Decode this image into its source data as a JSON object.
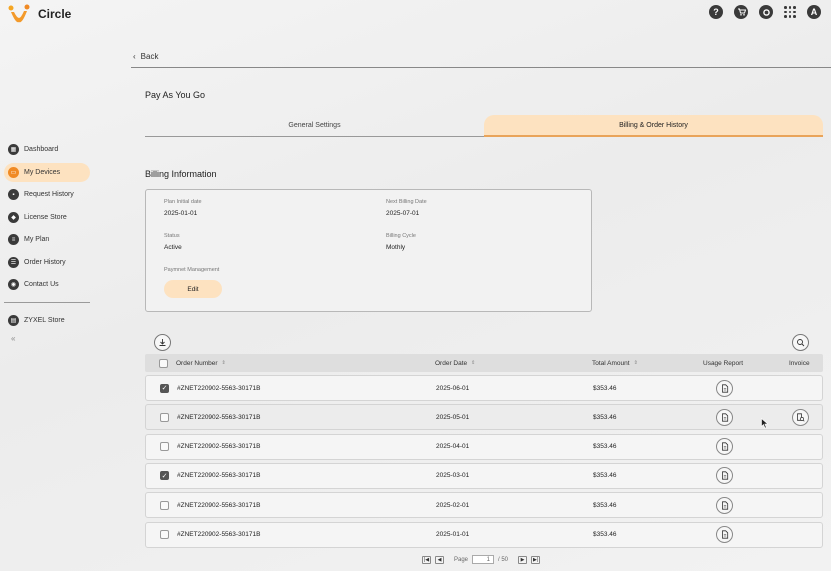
{
  "app": {
    "name": "Circle"
  },
  "header": {
    "help_icon": "question-icon",
    "cart_icon": "cart-icon",
    "settings_icon": "gear-icon",
    "apps_icon": "grid-icon",
    "avatar_letter": "A"
  },
  "sidebar": {
    "items": [
      {
        "label": "Dashboard",
        "icon": "dashboard-icon",
        "active": false
      },
      {
        "label": "My Devices",
        "icon": "devices-icon",
        "active": true
      },
      {
        "label": "Request History",
        "icon": "lock-icon",
        "active": false
      },
      {
        "label": "License Store",
        "icon": "license-icon",
        "active": false
      },
      {
        "label": "My Plan",
        "icon": "plan-icon",
        "active": false
      },
      {
        "label": "Order History",
        "icon": "order-icon",
        "active": false
      },
      {
        "label": "Contact Us",
        "icon": "contact-icon",
        "active": false
      }
    ],
    "store": {
      "label": "ZYXEL Store",
      "icon": "store-icon"
    },
    "collapse_label": "«"
  },
  "main": {
    "back_label": "Back",
    "page_title": "Pay As You Go",
    "tabs": [
      {
        "label": "General Settings",
        "active": false
      },
      {
        "label": "Billing & Order History",
        "active": true
      }
    ],
    "billing": {
      "title": "Billing Information",
      "plan_initial_date_label": "Plan Initial date",
      "plan_initial_date": "2025-01-01",
      "next_billing_date_label": "Next Billing Date",
      "next_billing_date": "2025-07-01",
      "status_label": "Status",
      "status": "Active",
      "billing_cycle_label": "Billing Cycle",
      "billing_cycle": "Mothly",
      "payment_label": "Paymnet Management",
      "edit_label": "Edit"
    },
    "table": {
      "columns": {
        "order_number": "Order Number",
        "order_date": "Order Date",
        "total_amount": "Total Amount",
        "usage_report": "Usage Report",
        "invoice": "Invoice"
      },
      "rows": [
        {
          "order": "#ZNET220902-5563-30171B",
          "date": "2025-06-01",
          "amount": "$353.46",
          "checked": true,
          "invoice": false
        },
        {
          "order": "#ZNET220902-5563-30171B",
          "date": "2025-05-01",
          "amount": "$353.46",
          "checked": false,
          "invoice": true
        },
        {
          "order": "#ZNET220902-5563-30171B",
          "date": "2025-04-01",
          "amount": "$353.46",
          "checked": false,
          "invoice": false
        },
        {
          "order": "#ZNET220902-5563-30171B",
          "date": "2025-03-01",
          "amount": "$353.46",
          "checked": true,
          "invoice": false
        },
        {
          "order": "#ZNET220902-5563-30171B",
          "date": "2025-02-01",
          "amount": "$353.46",
          "checked": false,
          "invoice": false
        },
        {
          "order": "#ZNET220902-5563-30171B",
          "date": "2025-01-01",
          "amount": "$353.46",
          "checked": false,
          "invoice": false
        }
      ]
    },
    "pagination": {
      "page_label": "Page",
      "current_page": "1",
      "total_pages": "/ 50"
    }
  },
  "colors": {
    "accent": "#f08a24",
    "accent_light": "#fde2c0"
  }
}
